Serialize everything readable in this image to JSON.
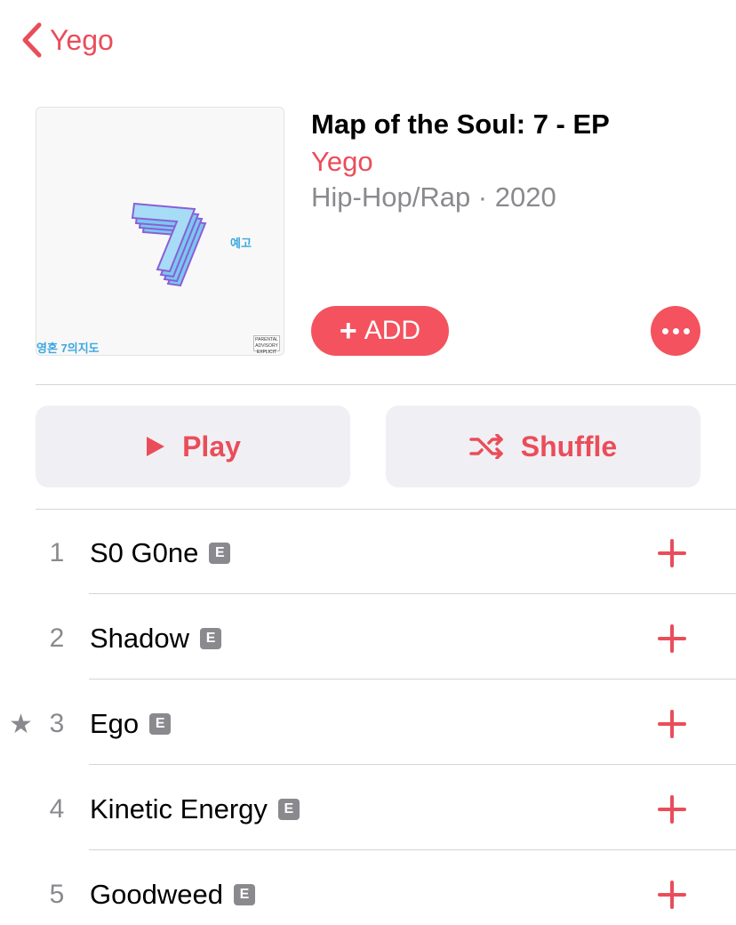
{
  "nav": {
    "back_label": "Yego"
  },
  "album": {
    "title": "Map of the Soul: 7 - EP",
    "artist": "Yego",
    "meta": "Hip-Hop/Rap · 2020",
    "art_side_text": "예고",
    "art_footer_text": "영혼 7의지도",
    "art_advisory_text": "PARENTAL ADVISORY EXPLICIT CONTENT"
  },
  "actions": {
    "add_label": "ADD",
    "play_label": "Play",
    "shuffle_label": "Shuffle"
  },
  "explicit_badge": "E",
  "tracks": [
    {
      "number": "1",
      "title": "S0 G0ne",
      "starred": false
    },
    {
      "number": "2",
      "title": "Shadow",
      "starred": false
    },
    {
      "number": "3",
      "title": "Ego",
      "starred": true
    },
    {
      "number": "4",
      "title": "Kinetic Energy",
      "starred": false
    },
    {
      "number": "5",
      "title": "Goodweed",
      "starred": false
    }
  ],
  "colors": {
    "accent": "#ea4d5a",
    "secondary_text": "#8a8a8e",
    "button_bg": "#f0f0f4"
  }
}
